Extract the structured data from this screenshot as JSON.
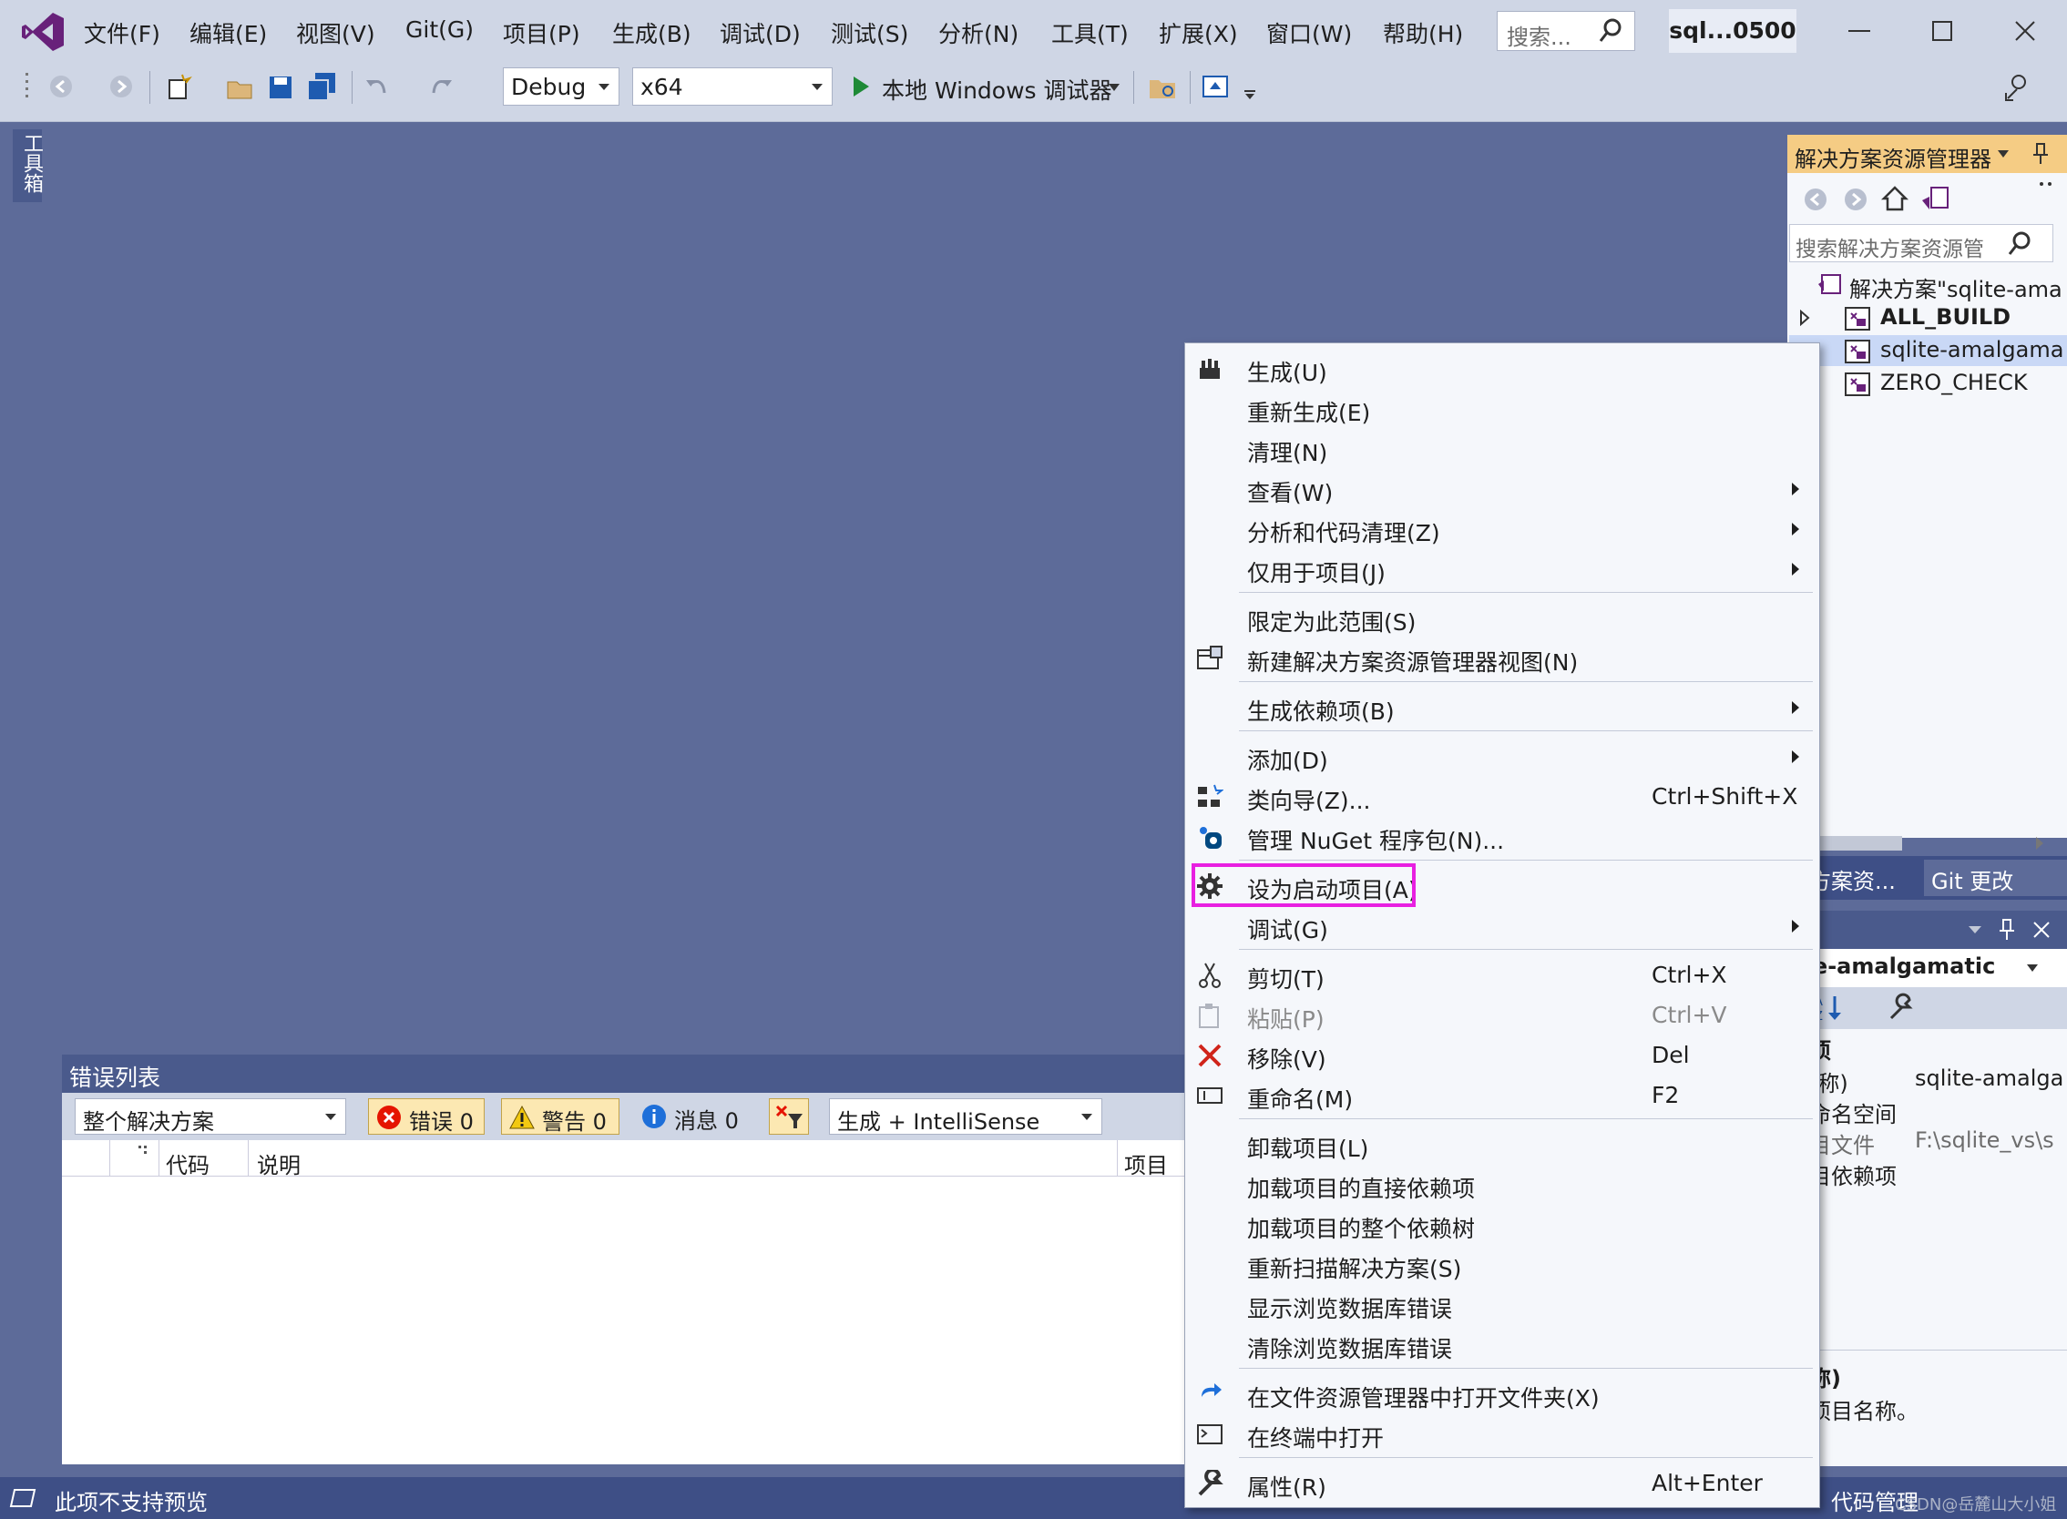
{
  "menubar": {
    "items": [
      "文件(F)",
      "编辑(E)",
      "视图(V)",
      "Git(G)",
      "项目(P)",
      "生成(B)",
      "调试(D)",
      "测试(S)",
      "分析(N)",
      "工具(T)",
      "扩展(X)",
      "窗口(W)",
      "帮助(H)"
    ],
    "search_placeholder": "搜索...",
    "solution_name": "sql...0500"
  },
  "toolbar": {
    "config": "Debug",
    "platform": "x64",
    "run_label": "本地 Windows 调试器"
  },
  "toolbox_tab": "工具箱",
  "solution_explorer": {
    "title": "解决方案资源管理器",
    "search_placeholder": "搜索解决方案资源管",
    "items": [
      {
        "label": "解决方案\"sqlite-ama",
        "bold": false
      },
      {
        "label": "ALL_BUILD",
        "bold": true
      },
      {
        "label": "sqlite-amalgama",
        "bold": false
      },
      {
        "label": "ZERO_CHECK",
        "bold": false
      }
    ],
    "tab_solution": "决方案资...",
    "tab_git": "Git 更改"
  },
  "properties": {
    "title": "性",
    "object": "lite-amalgamatic",
    "category": "杂项",
    "rows": [
      {
        "name": "(名称)",
        "value": "sqlite-amalga"
      },
      {
        "name": "根命名空间",
        "value": ""
      },
      {
        "name": "项目文件",
        "value": "F:\\sqlite_vs\\s"
      },
      {
        "name": "项目依赖项",
        "value": ""
      }
    ],
    "desc_title": "名称)",
    "desc_text": "定项目名称。"
  },
  "error_list": {
    "title": "错误列表",
    "scope": "整个解决方案",
    "errors": "错误 0",
    "warnings": "警告 0",
    "messages": "消息 0",
    "source": "生成 + IntelliSense",
    "col_code": "代码",
    "col_desc": "说明",
    "col_project": "项目"
  },
  "statusbar": {
    "left": "此项不支持预览",
    "right": "代码管理",
    "watermark": "CSDN@岳麓山大小姐"
  },
  "context_menu": [
    {
      "label": "生成(U)",
      "shortcut": "",
      "submenu": false,
      "icon": "build-icon"
    },
    {
      "label": "重新生成(E)",
      "shortcut": "",
      "submenu": false
    },
    {
      "label": "清理(N)",
      "shortcut": "",
      "submenu": false
    },
    {
      "label": "查看(W)",
      "shortcut": "",
      "submenu": true
    },
    {
      "label": "分析和代码清理(Z)",
      "shortcut": "",
      "submenu": true
    },
    {
      "label": "仅用于项目(J)",
      "shortcut": "",
      "submenu": true
    },
    {
      "label": "限定为此范围(S)",
      "shortcut": "",
      "submenu": false
    },
    {
      "label": "新建解决方案资源管理器视图(N)",
      "shortcut": "",
      "submenu": false,
      "icon": "new-view-icon"
    },
    {
      "label": "生成依赖项(B)",
      "shortcut": "",
      "submenu": true
    },
    {
      "label": "添加(D)",
      "shortcut": "",
      "submenu": true
    },
    {
      "label": "类向导(Z)...",
      "shortcut": "Ctrl+Shift+X",
      "submenu": false,
      "icon": "class-wizard-icon"
    },
    {
      "label": "管理 NuGet 程序包(N)...",
      "shortcut": "",
      "submenu": false,
      "icon": "nuget-icon"
    },
    {
      "label": "设为启动项目(A)",
      "shortcut": "",
      "submenu": false,
      "icon": "gear-icon"
    },
    {
      "label": "调试(G)",
      "shortcut": "",
      "submenu": true
    },
    {
      "label": "剪切(T)",
      "shortcut": "Ctrl+X",
      "submenu": false,
      "icon": "cut-icon"
    },
    {
      "label": "粘贴(P)",
      "shortcut": "Ctrl+V",
      "submenu": false,
      "icon": "paste-icon",
      "disabled": true
    },
    {
      "label": "移除(V)",
      "shortcut": "Del",
      "submenu": false,
      "icon": "remove-icon"
    },
    {
      "label": "重命名(M)",
      "shortcut": "F2",
      "submenu": false,
      "icon": "rename-icon"
    },
    {
      "label": "卸载项目(L)",
      "shortcut": "",
      "submenu": false
    },
    {
      "label": "加载项目的直接依赖项",
      "shortcut": "",
      "submenu": false
    },
    {
      "label": "加载项目的整个依赖树",
      "shortcut": "",
      "submenu": false
    },
    {
      "label": "重新扫描解决方案(S)",
      "shortcut": "",
      "submenu": false
    },
    {
      "label": "显示浏览数据库错误",
      "shortcut": "",
      "submenu": false
    },
    {
      "label": "清除浏览数据库错误",
      "shortcut": "",
      "submenu": false
    },
    {
      "label": "在文件资源管理器中打开文件夹(X)",
      "shortcut": "",
      "submenu": false,
      "icon": "open-folder-icon"
    },
    {
      "label": "在终端中打开",
      "shortcut": "",
      "submenu": false,
      "icon": "terminal-icon"
    },
    {
      "label": "属性(R)",
      "shortcut": "Alt+Enter",
      "submenu": false,
      "icon": "wrench-icon"
    }
  ],
  "colors": {
    "highlight": "#e81fe1",
    "workspace": "#5d6b99",
    "accent": "#68217a"
  }
}
